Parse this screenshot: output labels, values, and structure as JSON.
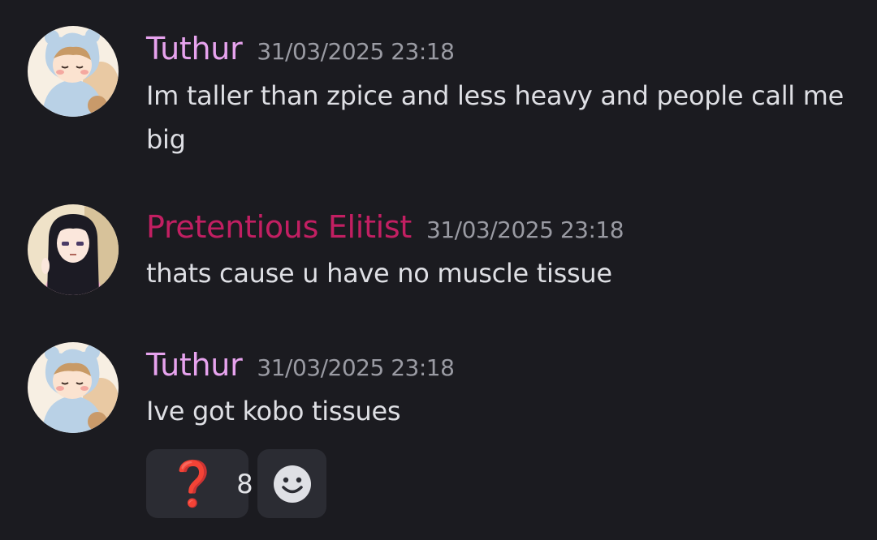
{
  "colors": {
    "background": "#1b1b20",
    "tuthur_name": "#e7a3ee",
    "elitist_name": "#c21f62",
    "timestamp": "#9a9ba3",
    "message_text": "#dedfe4",
    "reaction_bg": "#2b2c33",
    "question_red": "#d1223c"
  },
  "messages": [
    {
      "author": "Tuthur",
      "timestamp": "31/03/2025 23:18",
      "text": "Im taller than zpice and less heavy and people call me big",
      "avatar": "tuthur-avatar"
    },
    {
      "author": "Pretentious Elitist",
      "timestamp": "31/03/2025 23:18",
      "text": "thats cause u have no muscle tissue",
      "avatar": "elitist-avatar"
    },
    {
      "author": "Tuthur",
      "timestamp": "31/03/2025 23:18",
      "text": "Ive got kobo tissues",
      "avatar": "tuthur-avatar"
    }
  ],
  "reactions": [
    {
      "emoji": "❓",
      "icon": "question-mark-icon",
      "count": "8"
    },
    {
      "icon": "add-reaction-smile-icon"
    }
  ]
}
